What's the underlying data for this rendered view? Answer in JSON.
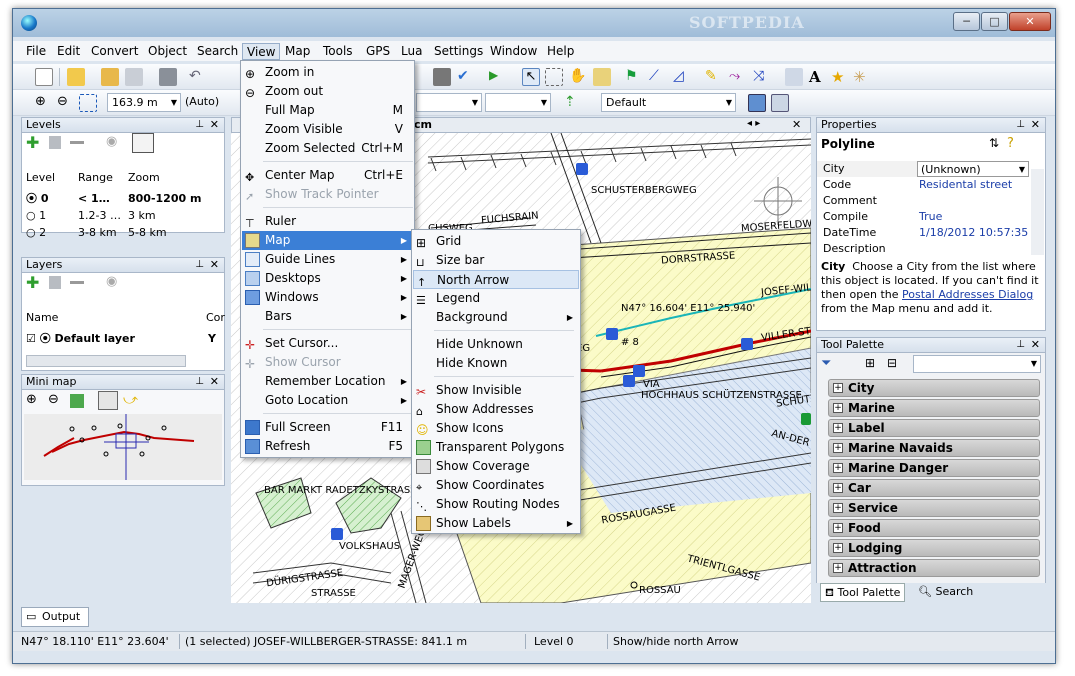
{
  "window": {
    "title_watermark": "SOFTPEDIA",
    "minimize": "─",
    "maximize": "□",
    "close": "✕"
  },
  "menubar": [
    "File",
    "Edit",
    "Convert",
    "Object",
    "Search",
    "View",
    "Map",
    "Tools",
    "GPS",
    "Lua",
    "Settings",
    "Window",
    "Help"
  ],
  "toolbar2": {
    "scale_value": "163.9 m",
    "zoom_mode": "(Auto)",
    "style_value": "Default"
  },
  "levels": {
    "title": "Levels",
    "columns": [
      "Level",
      "Range",
      "Zoom"
    ],
    "rows": [
      {
        "level": "0",
        "range": "< 1…",
        "zoom": "800-1200 m",
        "selected": true
      },
      {
        "level": "1",
        "range": "1.2-3 …",
        "zoom": "3 km",
        "selected": false
      },
      {
        "level": "2",
        "range": "3-8 km",
        "zoom": "5-8 km",
        "selected": false
      }
    ]
  },
  "layers": {
    "title": "Layers",
    "columns": [
      "Name",
      "Cor"
    ],
    "rows": [
      {
        "name": "Default layer",
        "value": "Y"
      }
    ]
  },
  "minimap": {
    "title": "Mini map"
  },
  "map_tab": {
    "label": "cm"
  },
  "map_labels": {
    "fuchsrain": "FUCHSRAIN",
    "chsweg": "CHSWEG",
    "schusterbergweg": "SCHUSTERBERGWEG",
    "mosenfeld": "MOSERFELDW",
    "dorrs": "DORRSTRASSE",
    "josef": "JOSEF-WIL",
    "coords": "N47° 16.604' E11° 25.940'",
    "hash8": "# 8",
    "willer": "VILLER-STR",
    "via": "VIA",
    "hochhaus": "HOCHHAUS SCHÜTZENSTRASSE",
    "schu": "SCHÜTZEN",
    "an_der": "AN-DER",
    "rossau": "ROSSAUGASSE",
    "trientl": "TRIENTLGASSE",
    "rossau2": "ROSSAU",
    "badetzky": "BAR MARKT RADETZKYSTRASSE",
    "volkshaus": "VOLKSHAUS",
    "durig": "DÜRIGSTRASSE",
    "mager": "MAGER-WEG",
    "strasse": "STRASSE",
    "eg": "EG"
  },
  "view_menu": [
    {
      "label": "Zoom in",
      "shortcut": "",
      "icon": "zoom-in-icon",
      "disabled": false,
      "sub": false
    },
    {
      "label": "Zoom out",
      "shortcut": "",
      "icon": "zoom-out-icon",
      "disabled": false,
      "sub": false
    },
    {
      "label": "Full Map",
      "shortcut": "M",
      "icon": "",
      "disabled": false,
      "sub": false
    },
    {
      "label": "Zoom Visible",
      "shortcut": "V",
      "icon": "",
      "disabled": false,
      "sub": false
    },
    {
      "label": "Zoom Selected",
      "shortcut": "Ctrl+M",
      "icon": "",
      "disabled": false,
      "sub": false
    },
    {
      "label": "Center Map",
      "shortcut": "Ctrl+E",
      "icon": "center-map-icon",
      "disabled": false,
      "sub": false
    },
    {
      "label": "Show Track Pointer",
      "shortcut": "",
      "icon": "track-pointer-icon",
      "disabled": true,
      "sub": false
    },
    {
      "label": "Ruler",
      "shortcut": "",
      "icon": "ruler-icon",
      "disabled": false,
      "sub": false
    },
    {
      "label": "Map",
      "shortcut": "",
      "icon": "map-icon",
      "disabled": false,
      "sub": true
    },
    {
      "label": "Guide Lines",
      "shortcut": "",
      "icon": "guide-lines-icon",
      "disabled": false,
      "sub": true
    },
    {
      "label": "Desktops",
      "shortcut": "",
      "icon": "desktops-icon",
      "disabled": false,
      "sub": true
    },
    {
      "label": "Windows",
      "shortcut": "",
      "icon": "windows-icon",
      "disabled": false,
      "sub": true
    },
    {
      "label": "Bars",
      "shortcut": "",
      "icon": "",
      "disabled": false,
      "sub": true
    },
    {
      "label": "Set Cursor...",
      "shortcut": "",
      "icon": "set-cursor-icon",
      "disabled": false,
      "sub": false
    },
    {
      "label": "Show Cursor",
      "shortcut": "",
      "icon": "show-cursor-icon",
      "disabled": true,
      "sub": false
    },
    {
      "label": "Remember Location",
      "shortcut": "",
      "icon": "",
      "disabled": false,
      "sub": true
    },
    {
      "label": "Goto Location",
      "shortcut": "",
      "icon": "",
      "disabled": false,
      "sub": true
    },
    {
      "label": "Full Screen",
      "shortcut": "F11",
      "icon": "full-screen-icon",
      "disabled": false,
      "sub": false
    },
    {
      "label": "Refresh",
      "shortcut": "F5",
      "icon": "refresh-icon",
      "disabled": false,
      "sub": false
    }
  ],
  "map_menu": [
    {
      "label": "Grid",
      "icon": "grid-icon",
      "sub": false
    },
    {
      "label": "Size bar",
      "icon": "size-bar-icon",
      "sub": false
    },
    {
      "label": "North Arrow",
      "icon": "north-arrow-icon",
      "sub": false
    },
    {
      "label": "Legend",
      "icon": "legend-icon",
      "sub": false
    },
    {
      "label": "Background",
      "icon": "",
      "sub": true
    },
    {
      "label": "Hide Unknown",
      "icon": "",
      "sub": false
    },
    {
      "label": "Hide Known",
      "icon": "",
      "sub": false
    },
    {
      "label": "Show Invisible",
      "icon": "show-invisible-icon",
      "sub": false
    },
    {
      "label": "Show Addresses",
      "icon": "show-addresses-icon",
      "sub": false
    },
    {
      "label": "Show Icons",
      "icon": "show-icons-icon",
      "sub": false
    },
    {
      "label": "Transparent Polygons",
      "icon": "transparent-polygons-icon",
      "sub": false
    },
    {
      "label": "Show Coverage",
      "icon": "show-coverage-icon",
      "sub": false
    },
    {
      "label": "Show Coordinates",
      "icon": "show-coordinates-icon",
      "sub": false
    },
    {
      "label": "Show Routing Nodes",
      "icon": "routing-nodes-icon",
      "sub": false
    },
    {
      "label": "Show Labels",
      "icon": "show-labels-icon",
      "sub": true
    }
  ],
  "properties": {
    "title": "Properties",
    "object_type": "Polyline",
    "rows": [
      {
        "key": "City",
        "value": "(Unknown)"
      },
      {
        "key": "Code",
        "value": "Residental street"
      },
      {
        "key": "Comment",
        "value": ""
      },
      {
        "key": "Compile",
        "value": "True"
      },
      {
        "key": "DateTime",
        "value": "1/18/2012 10:57:35 AM"
      },
      {
        "key": "Description",
        "value": ""
      }
    ],
    "help_title": "City",
    "help_text": "Choose a City from the list where this object is located. If you can't find it then open the",
    "help_link": "Postal Addresses Dialog",
    "help_tail": "from the Map menu and add it."
  },
  "tool_palette": {
    "title": "Tool Palette",
    "items": [
      "City",
      "Marine",
      "Label",
      "Marine Navaids",
      "Marine Danger",
      "Car",
      "Service",
      "Food",
      "Lodging",
      "Attraction"
    ],
    "tabs": [
      "Tool Palette",
      "Search"
    ]
  },
  "output_tab": "Output",
  "status": {
    "coords": "N47° 18.110' E11° 23.604'",
    "selection": "(1 selected) JOSEF-WILLBERGER-STRASSE: 841.1 m",
    "level": "Level 0",
    "hint": "Show/hide north Arrow"
  }
}
